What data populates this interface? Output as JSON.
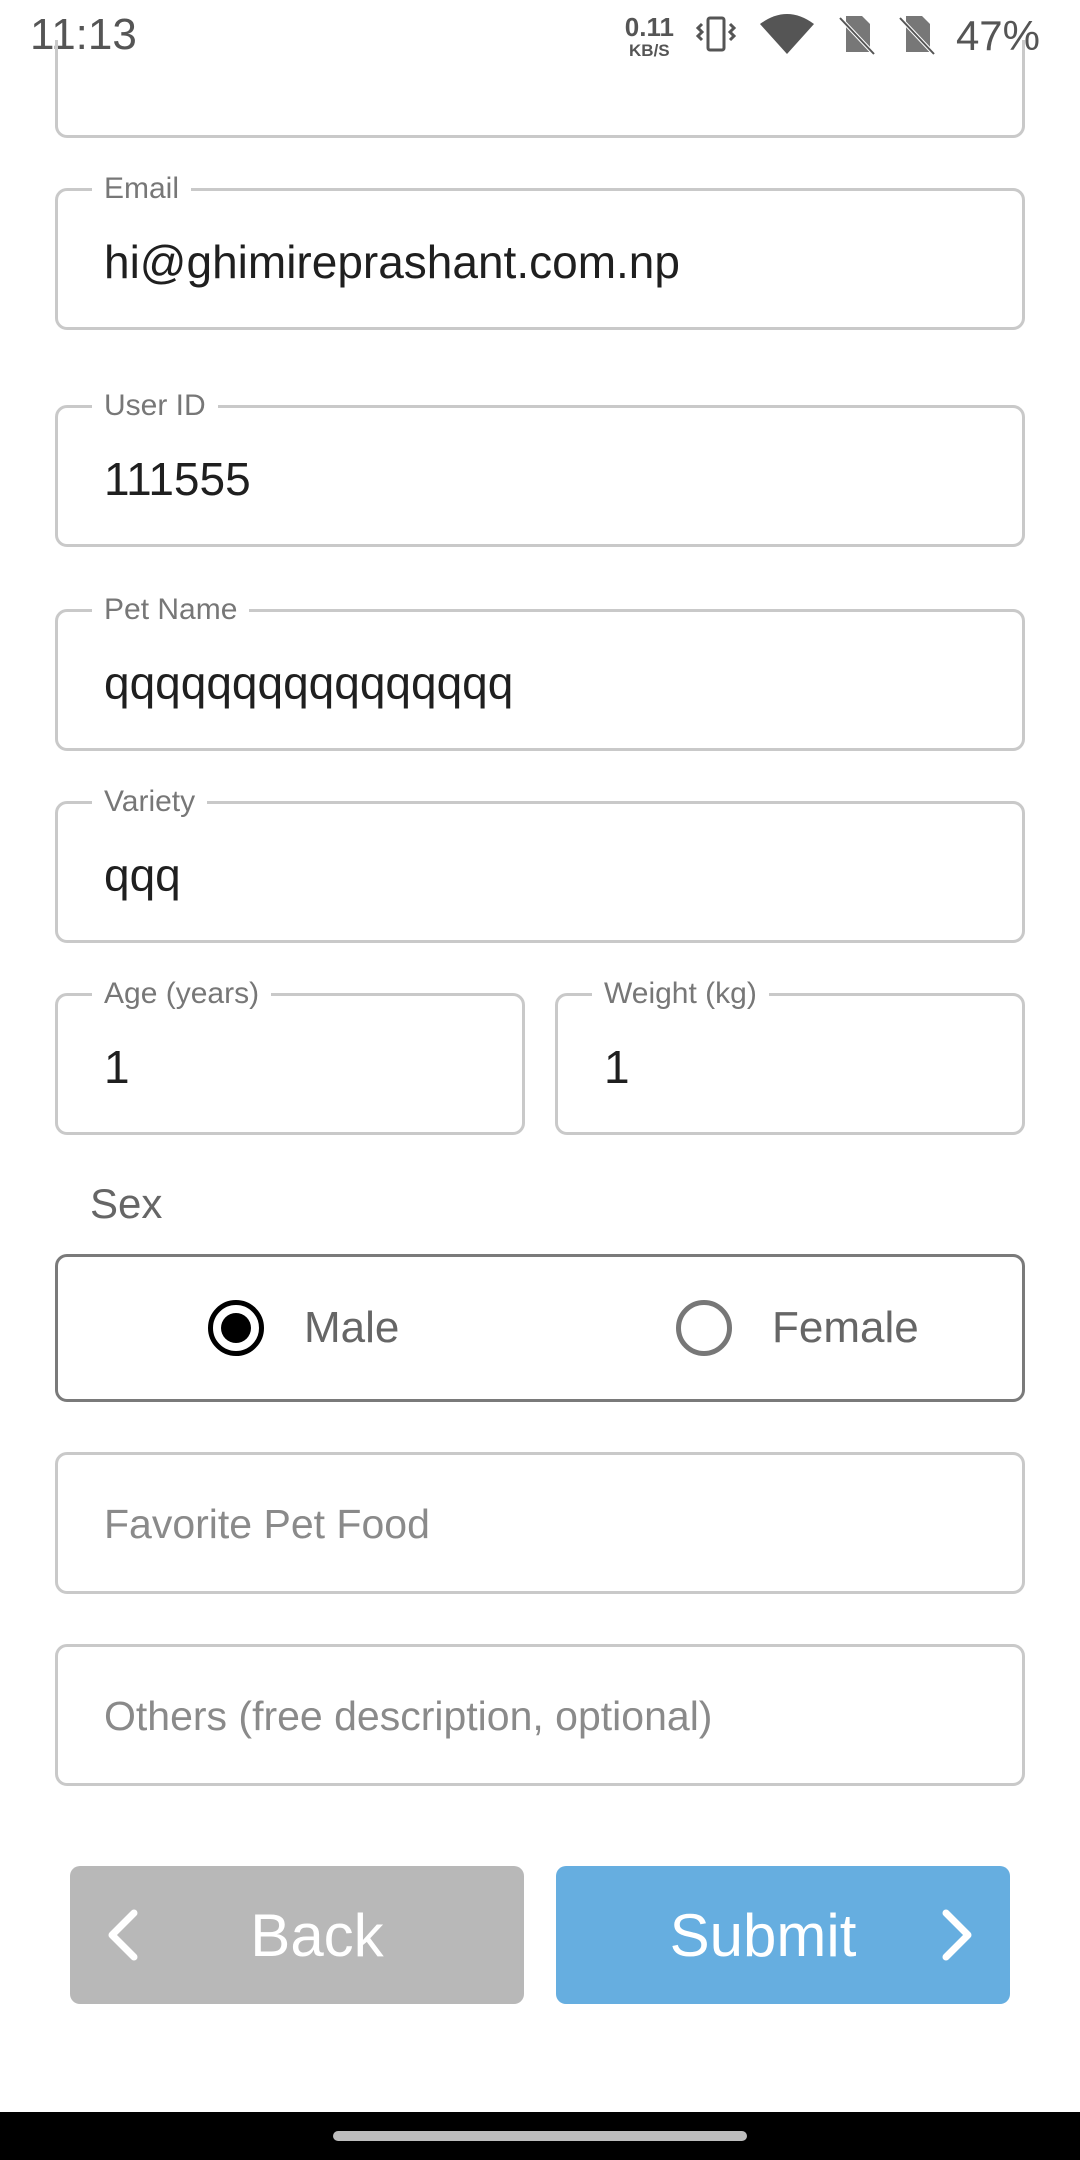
{
  "status_bar": {
    "time": "11:13",
    "net_speed_value": "0.11",
    "net_speed_unit": "KB/S",
    "battery": "47%",
    "icons": [
      "vibrate-icon",
      "wifi-icon",
      "no-sim-icon",
      "no-sim-icon",
      "battery-text"
    ]
  },
  "form": {
    "email": {
      "label": "Email",
      "value": "hi@ghimireprashant.com.np"
    },
    "user_id": {
      "label": "User ID",
      "value": "111555"
    },
    "pet_name": {
      "label": "Pet Name",
      "value": "qqqqqqqqqqqqqqqq"
    },
    "variety": {
      "label": "Variety",
      "value": "qqq"
    },
    "age": {
      "label": "Age (years)",
      "value": "1"
    },
    "weight": {
      "label": "Weight (kg)",
      "value": "1"
    },
    "sex": {
      "label": "Sex",
      "options": [
        {
          "label": "Male",
          "selected": true
        },
        {
          "label": "Female",
          "selected": false
        }
      ]
    },
    "favorite_food": {
      "placeholder": "Favorite Pet Food"
    },
    "others": {
      "placeholder": "Others (free description, optional)"
    }
  },
  "buttons": {
    "back": "Back",
    "submit": "Submit"
  },
  "colors": {
    "submit_bg": "#66aee0",
    "back_bg": "#b8b8b8",
    "field_border": "#c9c9c9"
  }
}
